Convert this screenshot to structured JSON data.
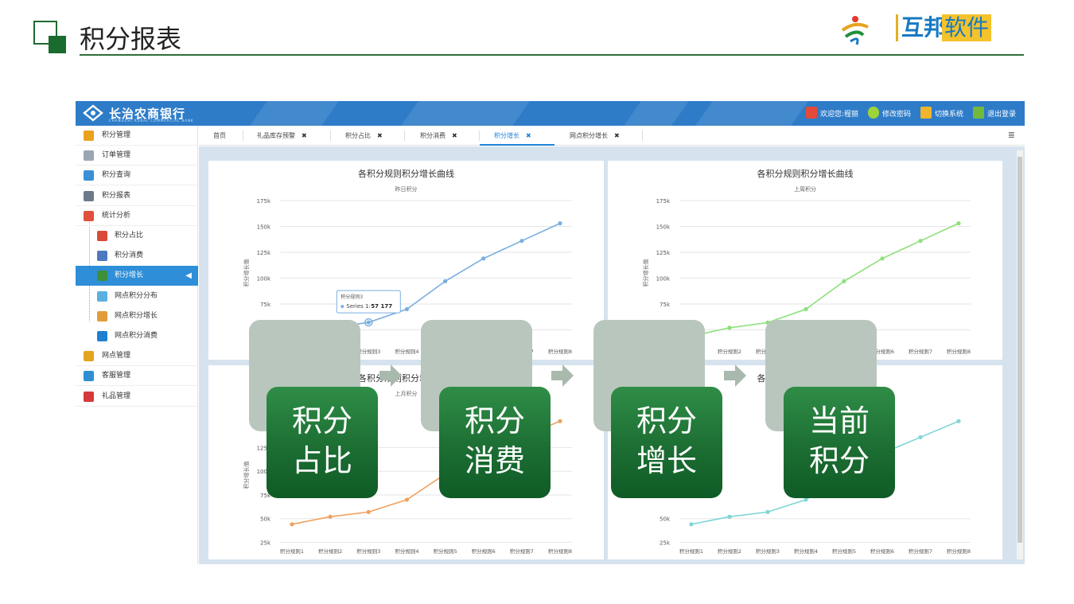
{
  "slide": {
    "title": "积分报表",
    "logo_text_a": "互邦",
    "logo_text_b": "软件"
  },
  "app": {
    "bank_name": "长治农商银行",
    "bank_sub": "CHANGZHI RURAL COMMERCIAL BANK",
    "top_links": [
      {
        "label": "欢迎您:程丽",
        "icon": "user-icon"
      },
      {
        "label": "修改密码",
        "icon": "shield-icon"
      },
      {
        "label": "切换系统",
        "icon": "switch-icon"
      },
      {
        "label": "退出登录",
        "icon": "exit-icon"
      }
    ],
    "sidebar": [
      {
        "label": "积分管理",
        "icon": "database-icon"
      },
      {
        "label": "订单管理",
        "icon": "edit-icon"
      },
      {
        "label": "积分查询",
        "icon": "search-icon"
      },
      {
        "label": "积分报表",
        "icon": "chart-icon"
      },
      {
        "label": "统计分析",
        "icon": "analysis-icon"
      },
      {
        "label": "积分占比",
        "icon": "pie-icon"
      },
      {
        "label": "积分消费",
        "icon": "consume-icon"
      },
      {
        "label": "积分增长",
        "icon": "growth-icon"
      },
      {
        "label": "网点积分分布",
        "icon": "distribution-icon"
      },
      {
        "label": "网点积分增长",
        "icon": "line-chart-icon"
      },
      {
        "label": "网点积分消费",
        "icon": "bar-chart-icon"
      },
      {
        "label": "网点管理",
        "icon": "house-icon"
      },
      {
        "label": "客服管理",
        "icon": "service-icon"
      },
      {
        "label": "礼品管理",
        "icon": "gift-icon"
      }
    ],
    "tabs": [
      {
        "label": "首页",
        "closable": false
      },
      {
        "label": "礼品库存预警",
        "closable": true
      },
      {
        "label": "积分占比",
        "closable": true
      },
      {
        "label": "积分消费",
        "closable": true
      },
      {
        "label": "积分增长",
        "closable": true
      },
      {
        "label": "网点积分增长",
        "closable": true
      }
    ],
    "active_tab": "积分增长",
    "close_glyph": "✖",
    "tooltip": {
      "title": "积分规则3",
      "series": "Series 1:",
      "value": "57 177"
    }
  },
  "overlay": {
    "boxes": [
      {
        "line1": "积分",
        "line2": "占比"
      },
      {
        "line1": "积分",
        "line2": "消费"
      },
      {
        "line1": "积分",
        "line2": "增长"
      },
      {
        "line1": "当前",
        "line2": "积分"
      }
    ]
  },
  "chart_data": [
    {
      "type": "line",
      "title": "各积分规则积分增长曲线",
      "subtitle": "昨日积分",
      "ylabel": "积分增长值",
      "categories": [
        "积分规则1",
        "积分规则2",
        "积分规则3",
        "积分规则4",
        "积分规则5",
        "积分规则6",
        "积分规则7",
        "积分规则8"
      ],
      "y_ticks": [
        "175k",
        "150k",
        "125k",
        "100k",
        "75k",
        "50k"
      ],
      "ylim": [
        35000,
        175000
      ],
      "series": [
        {
          "values": [
            44000,
            52000,
            57177,
            70000,
            97000,
            119000,
            136000,
            153000
          ],
          "color": "#7aaee0"
        }
      ]
    },
    {
      "type": "line",
      "title": "各积分规则积分增长曲线",
      "subtitle": "上周积分",
      "ylabel": "积分增长值",
      "categories": [
        "积分规则1",
        "积分规则2",
        "积分规则3",
        "积分规则4",
        "积分规则5",
        "积分规则6",
        "积分规则7",
        "积分规则8"
      ],
      "y_ticks": [
        "175k",
        "150k",
        "125k",
        "100k",
        "75k",
        "50k"
      ],
      "ylim": [
        35000,
        175000
      ],
      "series": [
        {
          "values": [
            44000,
            52000,
            57000,
            70000,
            97000,
            119000,
            136000,
            153000
          ],
          "color": "#8de07a"
        }
      ]
    },
    {
      "type": "line",
      "title": "各积分规则积分增长曲线",
      "subtitle": "上月积分",
      "ylabel": "积分增长值",
      "categories": [
        "积分规则1",
        "积分规则2",
        "积分规则3",
        "积分规则4",
        "积分规则5",
        "积分规则6",
        "积分规则7",
        "积分规则8"
      ],
      "y_ticks": [
        "125k",
        "100k",
        "75k",
        "50k",
        "25k"
      ],
      "ylim": [
        22000,
        170000
      ],
      "series": [
        {
          "values": [
            44000,
            52000,
            57000,
            70000,
            97000,
            119000,
            136000,
            153000
          ],
          "color": "#f0a15e"
        }
      ]
    },
    {
      "type": "line",
      "title": "各积分规则积分增长曲线",
      "subtitle": "",
      "ylabel": "",
      "categories": [
        "积分规则1",
        "积分规则2",
        "积分规则3",
        "积分规则4",
        "积分规则5",
        "积分规则6",
        "积分规则7",
        "积分规则8"
      ],
      "y_ticks": [
        "50k",
        "25k"
      ],
      "ylim": [
        22000,
        170000
      ],
      "series": [
        {
          "values": [
            44000,
            52000,
            57000,
            70000,
            97000,
            119000,
            136000,
            153000
          ],
          "color": "#7fd6d6"
        }
      ]
    }
  ]
}
